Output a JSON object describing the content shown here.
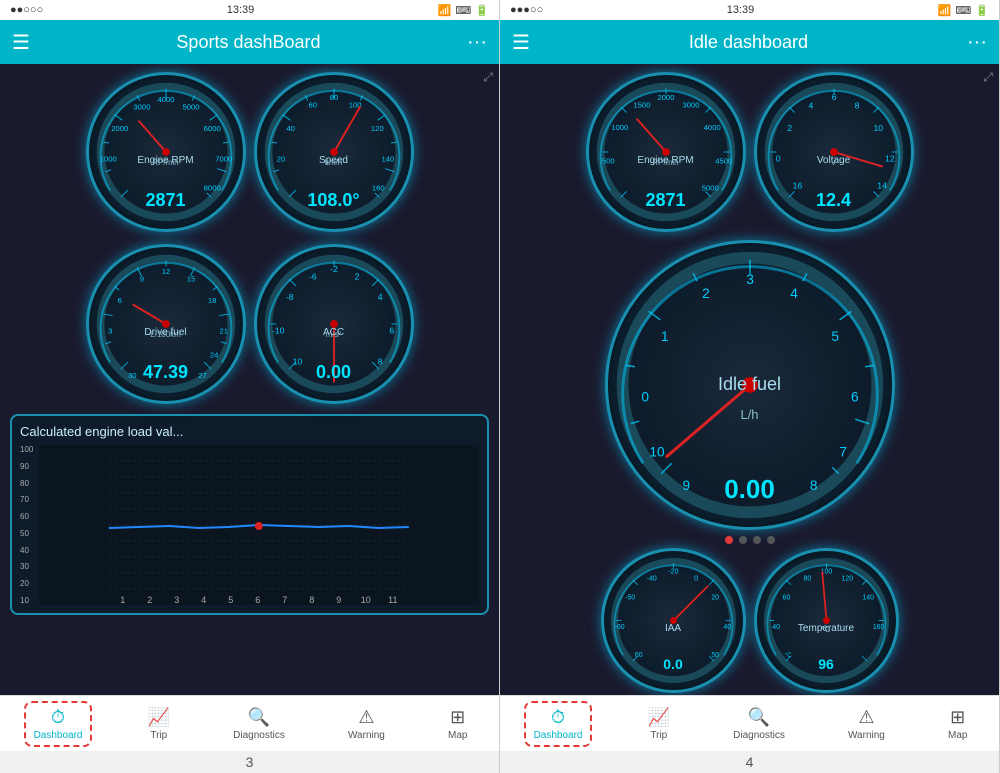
{
  "phone1": {
    "status": {
      "time": "13:39",
      "signal": "●●○○○",
      "wifi": "WiFi",
      "battery": "■■■■"
    },
    "navbar": {
      "title": "Sports dashBoard",
      "menu": "☰",
      "more": "···"
    },
    "gauges": {
      "rpm": {
        "label": "Engine RPM",
        "sublabel": "RP/min",
        "value": "2871",
        "min": 0,
        "max": 8000
      },
      "speed": {
        "label": "Speed",
        "sublabel": "km/h",
        "value": "108.0°",
        "min": 0,
        "max": 160
      },
      "driveFuel": {
        "label": "Drive fuel",
        "sublabel": "L/100km",
        "value": "47.39",
        "min": 0,
        "max": 30
      },
      "acc": {
        "label": "ACC",
        "sublabel": "m/s²",
        "value": "0.00",
        "min": -10,
        "max": 10
      }
    },
    "chart": {
      "title": "Calculated engine load val...",
      "yAxis": [
        "100",
        "90",
        "80",
        "70",
        "60",
        "50",
        "40",
        "30",
        "20",
        "10"
      ],
      "xAxis": [
        "1",
        "2",
        "3",
        "4",
        "5",
        "6",
        "7",
        "8",
        "9",
        "10",
        "11"
      ]
    },
    "tabs": [
      {
        "icon": "⏱",
        "label": "Dashboard",
        "active": true
      },
      {
        "icon": "📈",
        "label": "Trip",
        "active": false
      },
      {
        "icon": "🔍",
        "label": "Diagnostics",
        "active": false
      },
      {
        "icon": "⚠",
        "label": "Warning",
        "active": false
      },
      {
        "icon": "⊞",
        "label": "Map",
        "active": false
      }
    ],
    "pageNumber": "3"
  },
  "phone2": {
    "status": {
      "time": "13:39",
      "signal": "●●●○○",
      "wifi": "WiFi",
      "battery": "■■■■"
    },
    "navbar": {
      "title": "Idle dashboard",
      "menu": "☰",
      "more": "···"
    },
    "gauges": {
      "rpm": {
        "label": "Engine RPM",
        "sublabel": "RP/min",
        "value": "2871",
        "min": 0,
        "max": 5000
      },
      "voltage": {
        "label": "Voltage",
        "sublabel": "V",
        "value": "12.4",
        "min": 0,
        "max": 16
      },
      "idleFuel": {
        "label": "Idle fuel",
        "sublabel": "L/h",
        "value": "0.00",
        "min": 0,
        "max": 10
      },
      "iaa": {
        "label": "IAA",
        "sublabel": "",
        "value": "0.0",
        "min": -60,
        "max": 60
      },
      "temperature": {
        "label": "Temperature",
        "sublabel": "°C",
        "value": "96",
        "min": 40,
        "max": 160
      }
    },
    "tabs": [
      {
        "icon": "⏱",
        "label": "Dashboard",
        "active": true
      },
      {
        "icon": "📈",
        "label": "Trip",
        "active": false
      },
      {
        "icon": "🔍",
        "label": "Diagnostics",
        "active": false
      },
      {
        "icon": "⚠",
        "label": "Warning",
        "active": false
      },
      {
        "icon": "⊞",
        "label": "Map",
        "active": false
      }
    ],
    "pagination": [
      true,
      false,
      false,
      false
    ],
    "pageNumber": "4"
  }
}
